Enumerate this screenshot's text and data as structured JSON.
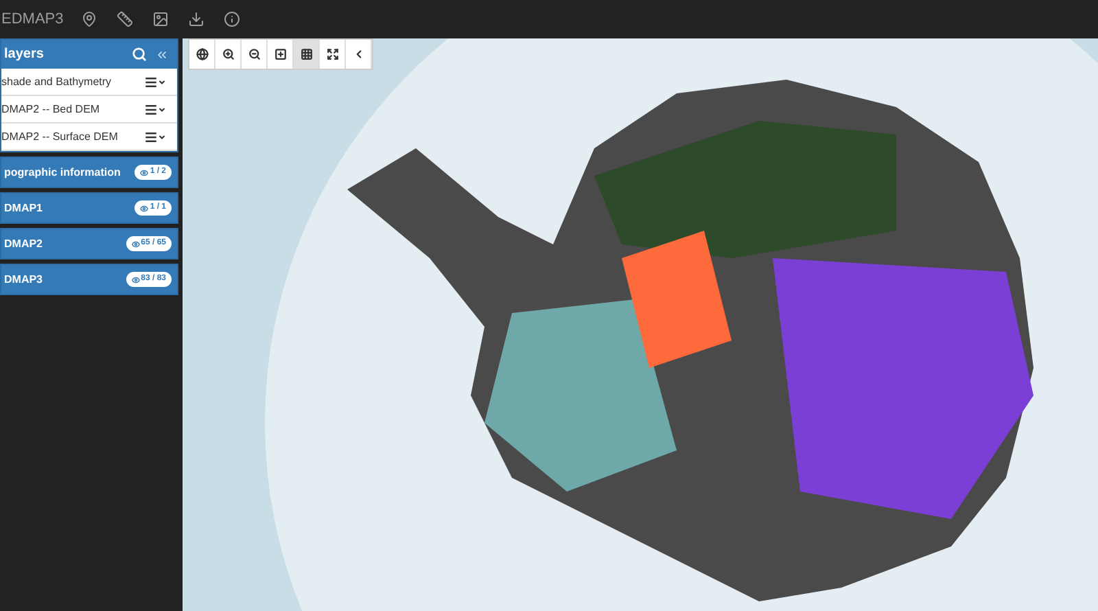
{
  "app_title": "EDMAP3",
  "layers_panel": {
    "title": "layers",
    "items": [
      {
        "name": "shade and Bathymetry"
      },
      {
        "name": "DMAP2 -- Bed DEM"
      },
      {
        "name": "DMAP2 -- Surface DEM"
      }
    ]
  },
  "groups": [
    {
      "title": "pographic information",
      "count": "1 / 2"
    },
    {
      "title": "DMAP1",
      "count": "1 / 1"
    },
    {
      "title": "DMAP2",
      "count": "65 / 65"
    },
    {
      "title": "DMAP3",
      "count": "83 / 83"
    }
  ],
  "map_toolbar": [
    {
      "kind": "globe",
      "selected": false
    },
    {
      "kind": "zoom-in",
      "selected": false
    },
    {
      "kind": "zoom-out",
      "selected": false
    },
    {
      "kind": "extent",
      "selected": false
    },
    {
      "kind": "grid",
      "selected": true
    },
    {
      "kind": "fullscreen",
      "selected": false
    },
    {
      "kind": "collapse",
      "selected": false
    }
  ]
}
